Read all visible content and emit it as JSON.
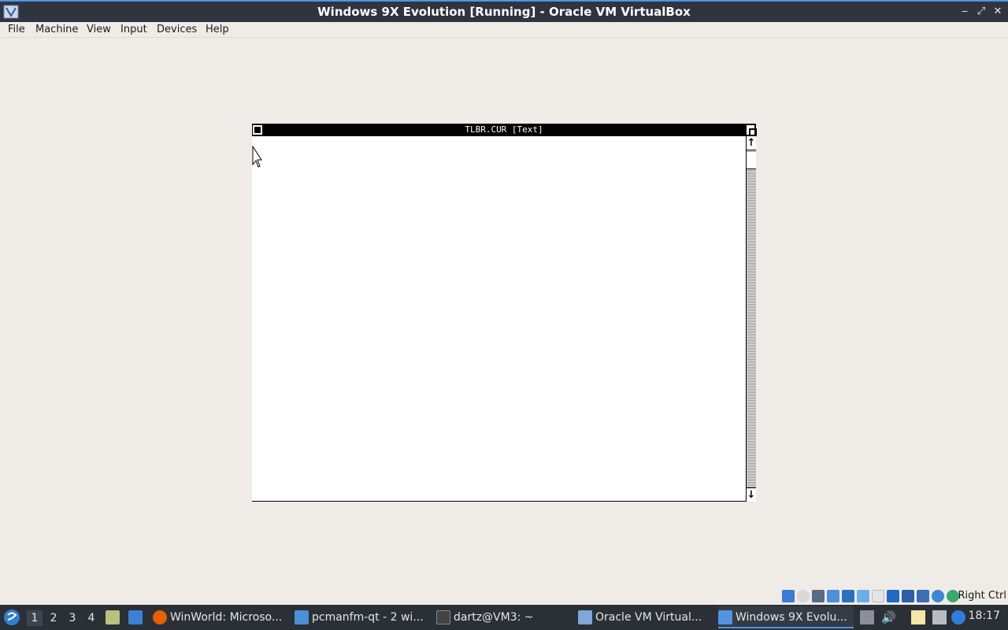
{
  "host_window": {
    "title": "Windows 9X Evolution [Running] - Oracle VM VirtualBox",
    "controls": {
      "minimize": "‒",
      "restore": "⤢",
      "close": "✕"
    }
  },
  "menubar": {
    "items": [
      "File",
      "Machine",
      "View",
      "Input",
      "Devices",
      "Help"
    ]
  },
  "guest_window": {
    "caption": "TLBR.CUR [Text]",
    "scroll_up": "↑",
    "scroll_down": "↓"
  },
  "status_bar": {
    "host_key": "Right Ctrl",
    "icons": [
      "hard-disk-icon",
      "optical-drive-icon",
      "floppy-icon",
      "audio-icon",
      "network-icon",
      "usb-icon",
      "shared-folders-icon",
      "display-icon",
      "video-capture-icon",
      "cpu-icon",
      "mouse-integration-icon",
      "keyboard-icon"
    ]
  },
  "taskbar": {
    "desktops": [
      "1",
      "2",
      "3",
      "4"
    ],
    "active_desktop": "1",
    "tasks": [
      {
        "label": "WinWorld: Microso...",
        "icon": "firefox-icon",
        "color": "#e66000"
      },
      {
        "label": "pcmanfm-qt - 2 wi...",
        "icon": "folder-icon",
        "color": "#4a90d9"
      },
      {
        "label": "dartz@VM3: ~",
        "icon": "terminal-icon",
        "color": "#444444"
      },
      {
        "label": "Oracle VM Virtual...",
        "icon": "virtualbox-icon",
        "color": "#7fa7d8"
      },
      {
        "label": "Windows 9X Evolu...",
        "icon": "virtualbox-vm-icon",
        "color": "#5294e2",
        "active": true
      }
    ],
    "clock": "18:17"
  }
}
